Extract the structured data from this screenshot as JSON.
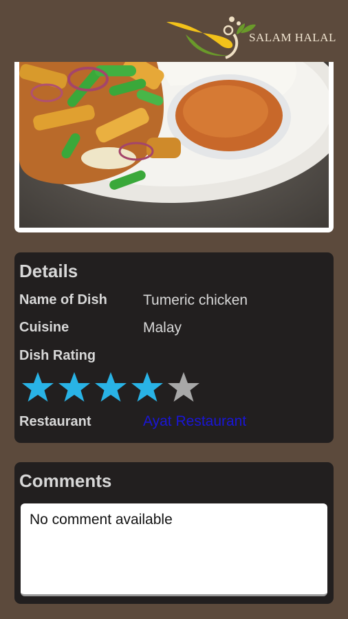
{
  "app": {
    "brand_name": "SALAM HALAL",
    "colors": {
      "background": "#5c4a3c",
      "card": "#221f1f",
      "label_text": "#d8d8d8",
      "link": "#1a16d6",
      "star_filled": "#29b3e6",
      "star_empty": "#a8a8a8"
    }
  },
  "photo": {
    "description_icon": "dish-photo"
  },
  "details": {
    "title": "Details",
    "name_label": "Name of Dish",
    "name_value": "Tumeric chicken",
    "cuisine_label": "Cuisine",
    "cuisine_value": "Malay",
    "rating_label": "Dish Rating",
    "rating": 4,
    "rating_max": 5,
    "restaurant_label": "Restaurant",
    "restaurant_value": "Ayat Restaurant"
  },
  "comments": {
    "title": "Comments",
    "text": "No comment available"
  }
}
